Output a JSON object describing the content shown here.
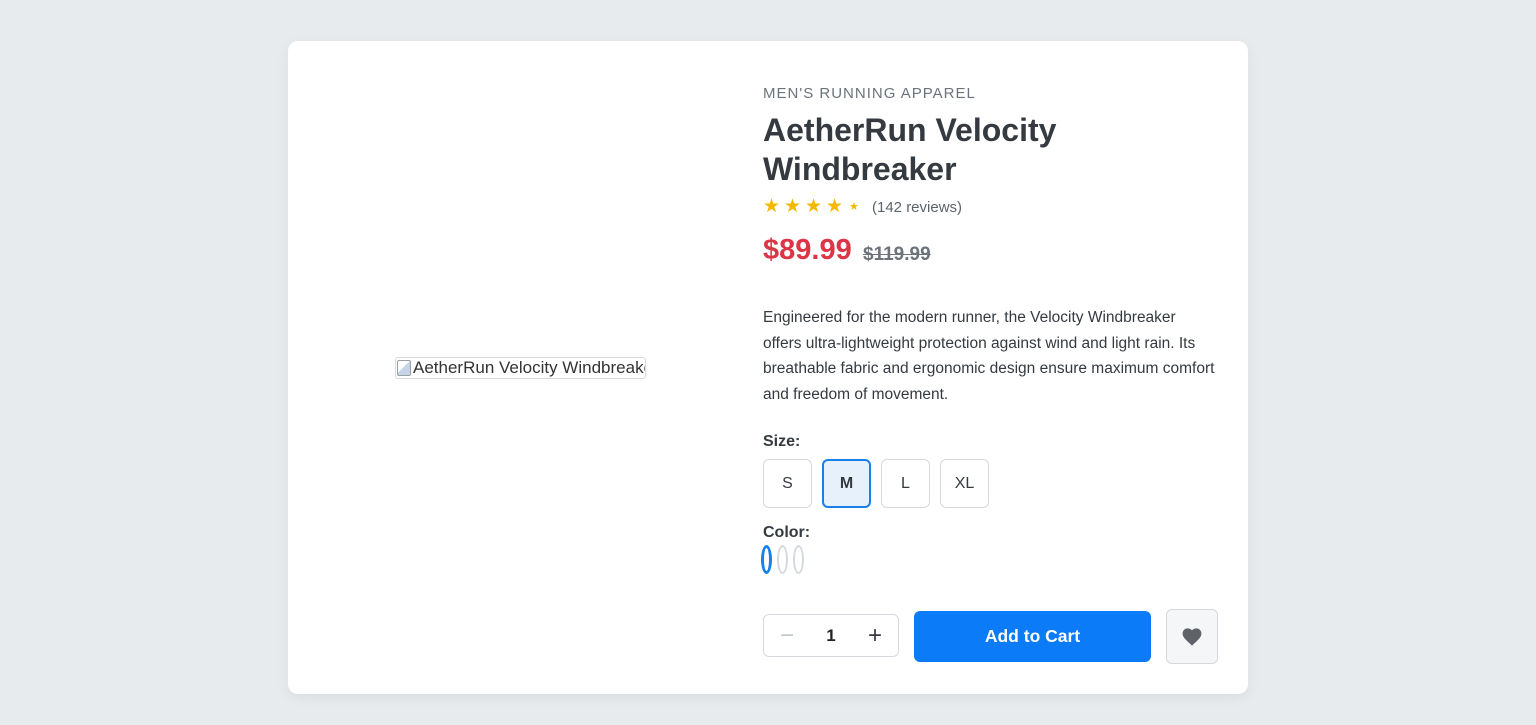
{
  "product": {
    "image_alt": "AetherRun Velocity Windbreaker",
    "category": "MEN'S RUNNING APPAREL",
    "title": "AetherRun Velocity Windbreaker",
    "rating": 4,
    "rating_max": 5,
    "reviews_text": "(142 reviews)",
    "price": "$89.99",
    "original_price": "$119.99",
    "description": "Engineered for the modern runner, the Velocity Windbreaker offers ultra-lightweight protection against wind and light rain. Its breathable fabric and ergonomic design ensure maximum comfort and freedom of movement."
  },
  "size_selector": {
    "label": "Size:",
    "options": [
      "S",
      "M",
      "L",
      "XL"
    ],
    "selected": "M"
  },
  "color_selector": {
    "label": "Color:",
    "swatch_count": 3,
    "selected_index": 0
  },
  "purchase": {
    "quantity": "1",
    "decrement_symbol": "−",
    "increment_symbol": "+",
    "add_to_cart_label": "Add to Cart",
    "wishlist_icon": "heart-icon"
  },
  "colors": {
    "accent": "#0b7bf7",
    "price": "#dc3545",
    "star": "#f5b800"
  }
}
